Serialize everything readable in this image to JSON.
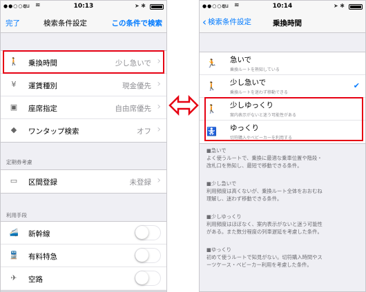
{
  "left": {
    "status": {
      "carrier": "au",
      "time": "10:13",
      "percent": ""
    },
    "nav": {
      "done": "完了",
      "title": "検索条件設定",
      "search": "この条件で検索"
    },
    "rows": [
      {
        "label": "乗換時間",
        "value": "少し急いで"
      },
      {
        "label": "運賃種別",
        "value": "現金優先"
      },
      {
        "label": "座席指定",
        "value": "自由席優先"
      },
      {
        "label": "ワンタップ検索",
        "value": "オフ"
      }
    ],
    "section_pass": "定期券考慮",
    "pass_row": {
      "label": "区間登録",
      "value": "未登録"
    },
    "section_means": "利用手段",
    "means": [
      {
        "label": "新幹線"
      },
      {
        "label": "有料特急"
      },
      {
        "label": "空路"
      }
    ]
  },
  "right": {
    "status": {
      "carrier": "au",
      "time": "10:14"
    },
    "nav": {
      "back": "検索条件設定",
      "title": "乗換時間"
    },
    "options": [
      {
        "title": "急いで",
        "sub": "乗換ルートを熟知している"
      },
      {
        "title": "少し急いで",
        "sub": "乗換ルートを迷わず移動できる"
      },
      {
        "title": "少しゆっくり",
        "sub": "案内表示がないと迷う可能性がある"
      },
      {
        "title": "ゆっくり",
        "sub": "切符購入やベビーカーを利用する"
      }
    ],
    "desc": [
      {
        "h": "■急いで",
        "b1": "よく使うルートで、乗換に最適な乗車位置や階段・",
        "b2": "改札口を熟知し、最短で移動できる条件。"
      },
      {
        "h": "■少し急いで",
        "b1": "利用頻度は高くないが、乗換ルート全体をおおむね",
        "b2": "理解し、迷わず移動できる条件。"
      },
      {
        "h": "■少しゆっくり",
        "b1": "利用頻度はほぼなく、案内表示がないと迷う可能性",
        "b2": "がある。また数分程度の列車遅延を考慮した条件。"
      },
      {
        "h": "■ゆっくり",
        "b1": "初めて使うルートで知見がない。切符購入時間やス",
        "b2": "ーツケース・ベビーカー利用を考慮した条件。"
      }
    ]
  },
  "colors": {
    "accent": "#007aff",
    "highlight": "#e60012"
  }
}
